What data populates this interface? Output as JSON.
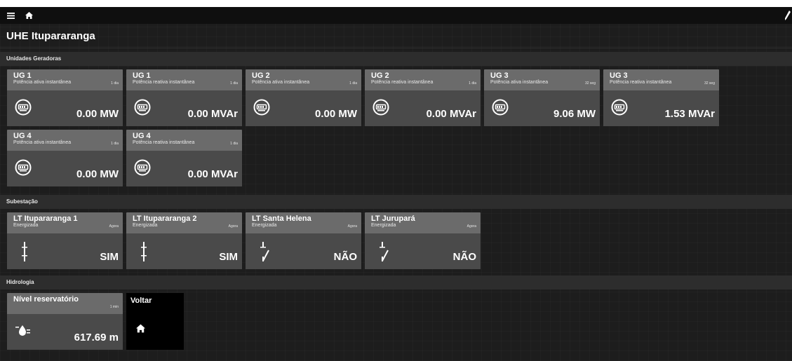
{
  "page_title": "UHE Itupararanga",
  "sections": {
    "geradoras": "Unidades Geradoras",
    "subestacao": "Subestação",
    "hidrologia": "Hidrologia"
  },
  "ug_tiles": [
    {
      "title": "UG 1",
      "subtitle": "Potência ativa instantânea",
      "time": "1 dia",
      "value": "0.00 MW"
    },
    {
      "title": "UG 1",
      "subtitle": "Potência reativa instantânea",
      "time": "1 dia",
      "value": "0.00 MVAr"
    },
    {
      "title": "UG 2",
      "subtitle": "Potência ativa instantânea",
      "time": "1 dia",
      "value": "0.00 MW"
    },
    {
      "title": "UG 2",
      "subtitle": "Potência reativa instantânea",
      "time": "1 dia",
      "value": "0.00 MVAr"
    },
    {
      "title": "UG 3",
      "subtitle": "Potência ativa instantânea",
      "time": "32 seg",
      "value": "9.06 MW"
    },
    {
      "title": "UG 3",
      "subtitle": "Potência reativa instantânea",
      "time": "32 seg",
      "value": "1.53 MVAr"
    },
    {
      "title": "UG 4",
      "subtitle": "Potência ativa instantânea",
      "time": "1 dia",
      "value": "0.00 MW"
    },
    {
      "title": "UG 4",
      "subtitle": "Potência reativa instantânea",
      "time": "1 dia",
      "value": "0.00 MVAr"
    }
  ],
  "lt_tiles": [
    {
      "title": "LT Itupararanga 1",
      "subtitle": "Energizada",
      "time": "Agora",
      "value": "SIM",
      "state": "closed"
    },
    {
      "title": "LT Itupararanga 2",
      "subtitle": "Energizada",
      "time": "Agora",
      "value": "SIM",
      "state": "closed"
    },
    {
      "title": "LT Santa Helena",
      "subtitle": "Energizada",
      "time": "Agora",
      "value": "NÃO",
      "state": "open"
    },
    {
      "title": "LT Jurupará",
      "subtitle": "Energizada",
      "time": "Agora",
      "value": "NÃO",
      "state": "open"
    }
  ],
  "hidro_tile": {
    "title": "Nível reservatório",
    "time": "1 min",
    "value": "617.69 m"
  },
  "back_tile": {
    "title": "Voltar"
  },
  "icons": {
    "menu": "menu-icon",
    "home": "home-icon",
    "edit": "pencil-icon",
    "meter": "meter-icon",
    "switch_closed": "switch-closed-icon",
    "switch_open": "switch-open-icon",
    "water": "water-level-icon"
  },
  "colors": {
    "tile": "#6b6b6b",
    "tile_body": "#4a4a4a",
    "section": "#2d2d2d",
    "background": "#1d1d1d"
  }
}
